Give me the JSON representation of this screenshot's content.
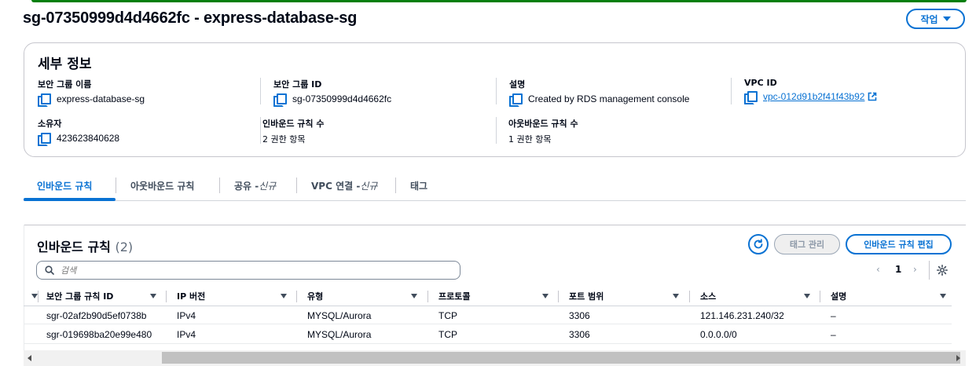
{
  "page": {
    "title": "sg-07350999d4d4662fc - express-database-sg",
    "actions_label": "작업"
  },
  "details": {
    "title": "세부 정보",
    "fields": {
      "sg_name": {
        "label": "보안 그룹 이름",
        "value": "express-database-sg"
      },
      "sg_id": {
        "label": "보안 그룹 ID",
        "value": "sg-07350999d4d4662fc"
      },
      "description": {
        "label": "설명",
        "value": "Created by RDS management console"
      },
      "vpc_id": {
        "label": "VPC ID",
        "value": "vpc-012d91b2f41f43b92"
      },
      "owner": {
        "label": "소유자",
        "value": "423623840628"
      },
      "inbound_count": {
        "label": "인바운드 규칙 수",
        "value": "2 권한 항목"
      },
      "outbound_count": {
        "label": "아웃바운드 규칙 수",
        "value": "1 권한 항목"
      }
    }
  },
  "tabs": {
    "inbound": "인바운드 규칙",
    "outbound": "아웃바운드 규칙",
    "sharing": "공유 - ",
    "sharing_new": "신규",
    "vpc_assoc": "VPC 연결 - ",
    "vpc_assoc_new": "신규",
    "tags": "태그"
  },
  "rules": {
    "title": "인바운드 규칙",
    "count": "(2)",
    "manage_tags_label": "태그 관리",
    "edit_label": "인바운드 규칙 편집",
    "search_placeholder": "검색",
    "pager": {
      "prev": "‹",
      "page": "1",
      "next": "›"
    },
    "columns": {
      "rule_id": "보안 그룹 규칙 ID",
      "ip_version": "IP 버전",
      "type": "유형",
      "protocol": "프로토콜",
      "port_range": "포트 범위",
      "source": "소스",
      "description": "설명"
    },
    "rows": [
      {
        "rule_id": "sgr-02af2b90d5ef0738b",
        "ip_version": "IPv4",
        "type": "MYSQL/Aurora",
        "protocol": "TCP",
        "port_range": "3306",
        "source": "121.146.231.240/32",
        "description": "–"
      },
      {
        "rule_id": "sgr-019698ba20e99e480",
        "ip_version": "IPv4",
        "type": "MYSQL/Aurora",
        "protocol": "TCP",
        "port_range": "3306",
        "source": "0.0.0.0/0",
        "description": "–"
      }
    ]
  },
  "colors": {
    "accent": "#0972d3",
    "success_bar": "#037f0c",
    "text": "#000716"
  },
  "icons": [
    "copy-icon",
    "external-link-icon",
    "refresh-icon",
    "search-icon",
    "settings-gear-icon",
    "sort-caret-icon",
    "chevron-down-icon"
  ]
}
